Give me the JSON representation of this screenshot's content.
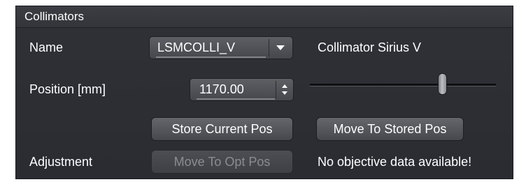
{
  "panel": {
    "title": "Collimators"
  },
  "name_row": {
    "label": "Name",
    "selected": "LSMCOLLI_V",
    "description": "Collimator Sirius V",
    "arrow_icon": "chevron-down-icon"
  },
  "position_row": {
    "label": "Position [mm]",
    "value": "1170.00",
    "spinner_icon": "spinner-arrows-icon"
  },
  "buttons": {
    "store_current": "Store Current Pos",
    "move_to_stored": "Move To Stored Pos",
    "move_to_opt": "Move To Opt Pos"
  },
  "adjustment_row": {
    "label": "Adjustment",
    "status": "No objective data available!"
  },
  "colors": {
    "panel_bg": "#2f3137",
    "text": "#ffffff",
    "disabled_text": "#8a8c91"
  }
}
